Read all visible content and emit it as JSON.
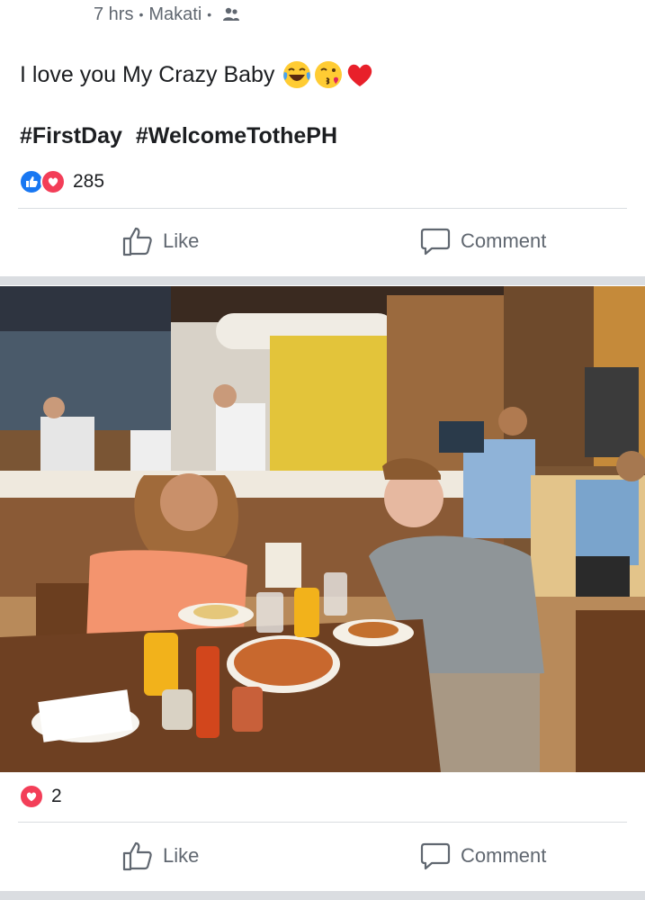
{
  "post": {
    "time": "7 hrs",
    "location": "Makati",
    "audience_icon": "friends-icon",
    "caption": "I love you My Crazy Baby",
    "caption_emojis": [
      "crying-laughing-emoji",
      "kiss-emoji",
      "red-heart-emoji"
    ],
    "hashtags": [
      "#FirstDay",
      "#WelcomeTothePH"
    ],
    "reaction_count": "285",
    "actions": {
      "like": "Like",
      "comment": "Comment"
    }
  },
  "second_post": {
    "reaction_count": "2",
    "actions": {
      "like": "Like",
      "comment": "Comment"
    }
  },
  "colors": {
    "like_blue": "#1877f2",
    "love_red": "#f33e58",
    "secondary_text": "#606770",
    "divider": "#dadde1"
  }
}
